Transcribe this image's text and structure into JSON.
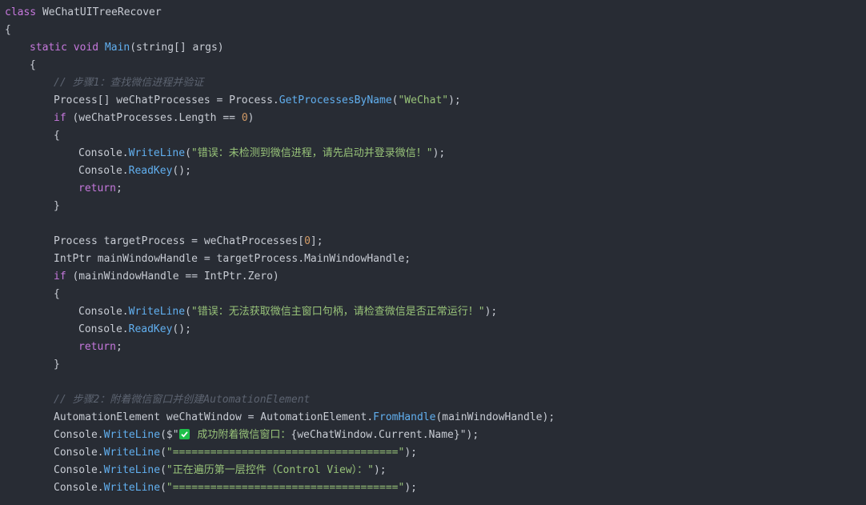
{
  "theme": {
    "background": "#282c34",
    "keyword": "#c678dd",
    "function": "#61afef",
    "string": "#98c379",
    "number": "#d19a66",
    "comment": "#5c6370",
    "text": "#c8ccd4",
    "check_icon": "#1fbf4a"
  },
  "code": {
    "l1": {
      "kw": "class",
      "name": " WeChatUITreeRecover"
    },
    "l2": {
      "brace": "{"
    },
    "l3": {
      "kw": "static void",
      "sp": " ",
      "fn": "Main",
      "rest": "(string[] args)"
    },
    "l4": {
      "brace": "{"
    },
    "l5": {
      "comment": "// 步骤1：查找微信进程并验证"
    },
    "l6": {
      "a": "Process[] weChatProcesses = Process.",
      "fn": "GetProcessesByName",
      "b": "(",
      "str": "\"WeChat\"",
      "c": ");"
    },
    "l7": {
      "kw": "if",
      "a": " (weChatProcesses.Length == ",
      "num": "0",
      "b": ")"
    },
    "l8": {
      "brace": "{"
    },
    "l9": {
      "a": "Console.",
      "fn": "WriteLine",
      "b": "(",
      "str": "\"错误：未检测到微信进程，请先启动并登录微信！\"",
      "c": ");"
    },
    "l10": {
      "a": "Console.",
      "fn": "ReadKey",
      "b": "();"
    },
    "l11": {
      "kw": "return",
      "b": ";"
    },
    "l12": {
      "brace": "}"
    },
    "l14": {
      "text": "Process targetProcess = weChatProcesses[",
      "num": "0",
      "b": "];"
    },
    "l15": {
      "text": "IntPtr mainWindowHandle = targetProcess.MainWindowHandle;"
    },
    "l16": {
      "kw": "if",
      "a": " (mainWindowHandle == IntPtr.Zero)"
    },
    "l17": {
      "brace": "{"
    },
    "l18": {
      "a": "Console.",
      "fn": "WriteLine",
      "b": "(",
      "str": "\"错误：无法获取微信主窗口句柄，请检查微信是否正常运行！\"",
      "c": ");"
    },
    "l19": {
      "a": "Console.",
      "fn": "ReadKey",
      "b": "();"
    },
    "l20": {
      "kw": "return",
      "b": ";"
    },
    "l21": {
      "brace": "}"
    },
    "l23": {
      "comment": "// 步骤2：附着微信窗口并创建AutomationElement"
    },
    "l24": {
      "a": "AutomationElement weChatWindow = AutomationElement.",
      "fn": "FromHandle",
      "b": "(mainWindowHandle);"
    },
    "l25": {
      "a": "Console.",
      "fn": "WriteLine",
      "b": "($\"",
      "str": " 成功附着微信窗口：",
      "c": "{weChatWindow.Current.Name}\");"
    },
    "l26": {
      "a": "Console.",
      "fn": "WriteLine",
      "b": "(",
      "str": "\"====================================\"",
      "c": ");"
    },
    "l27": {
      "a": "Console.",
      "fn": "WriteLine",
      "b": "(",
      "str": "\"正在遍历第一层控件（Control View）：\"",
      "c": ");"
    },
    "l28": {
      "a": "Console.",
      "fn": "WriteLine",
      "b": "(",
      "str": "\"====================================\"",
      "c": ");"
    }
  }
}
